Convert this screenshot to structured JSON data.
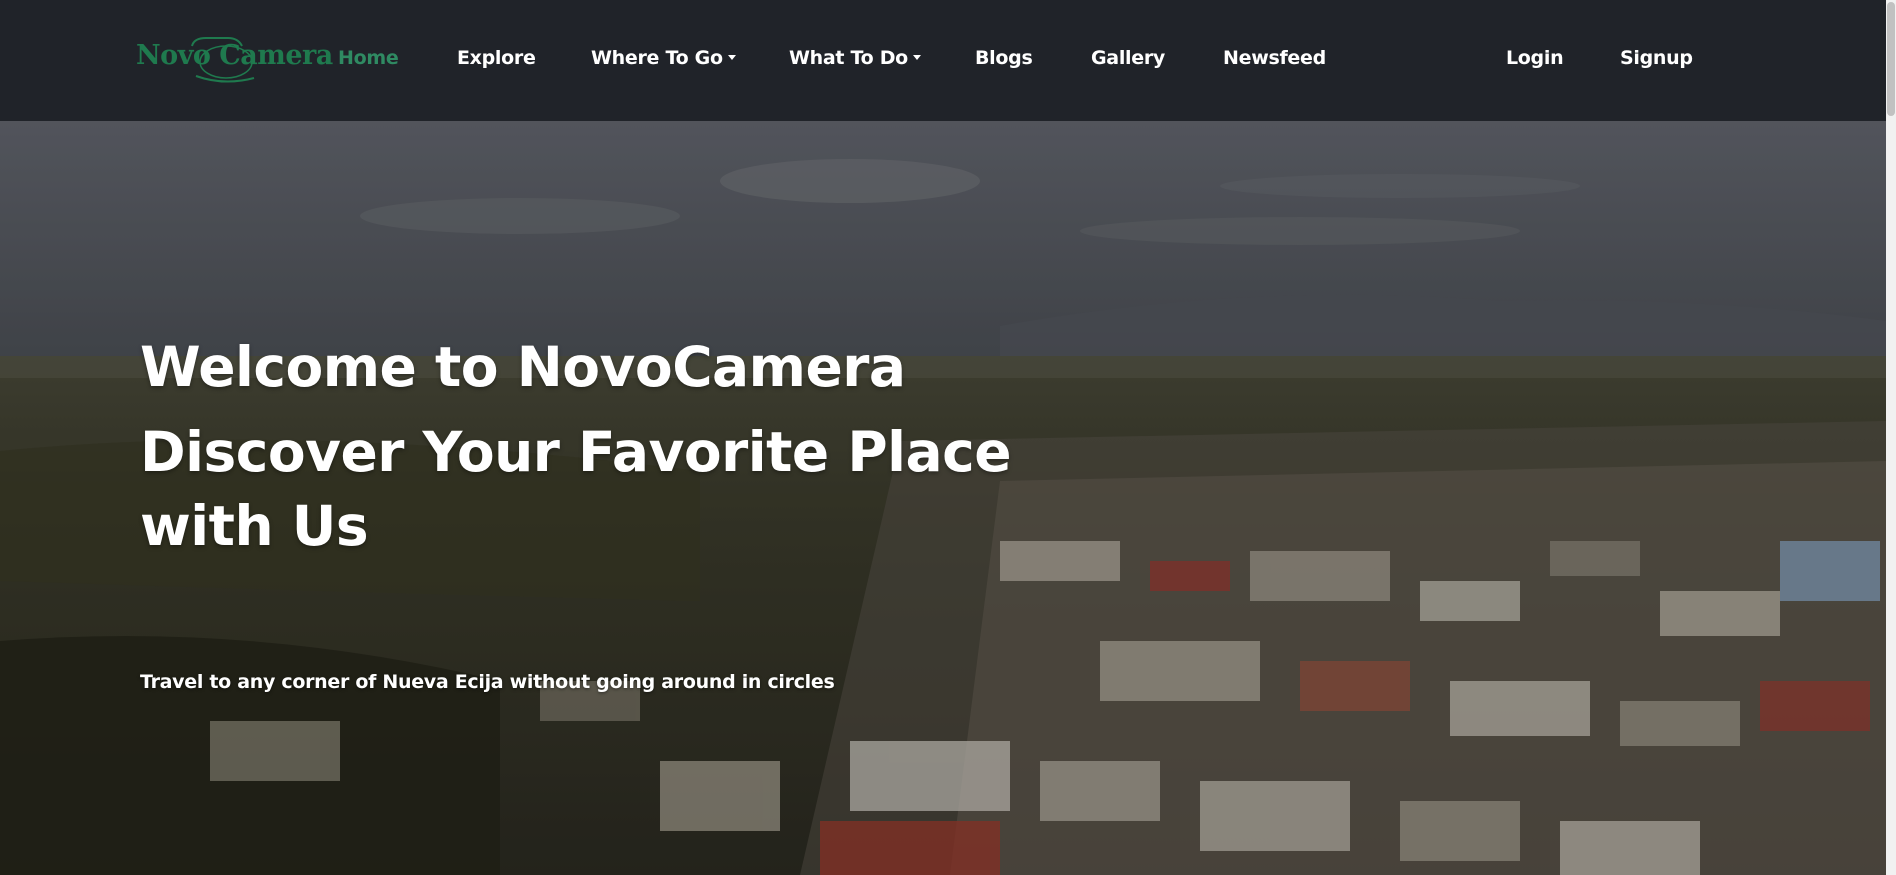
{
  "header": {
    "logo_text": "Novo Camera",
    "nav": {
      "home": "Home",
      "explore": "Explore",
      "where_to_go": "Where To Go",
      "what_to_do": "What To Do",
      "blogs": "Blogs",
      "gallery": "Gallery",
      "newsfeed": "Newsfeed",
      "login": "Login",
      "signup": "Signup"
    },
    "active_item": "Home"
  },
  "hero": {
    "title_line1": "Welcome to NovoCamera",
    "title_line2": "Discover Your Favorite Place",
    "title_line3": "with Us",
    "subtitle": "Travel to any corner of Nueva Ecija without going around in circles"
  },
  "colors": {
    "navbar_bg": "#202329",
    "accent": "#2f8a62",
    "logo": "#1f7a4e",
    "text": "#ffffff"
  }
}
